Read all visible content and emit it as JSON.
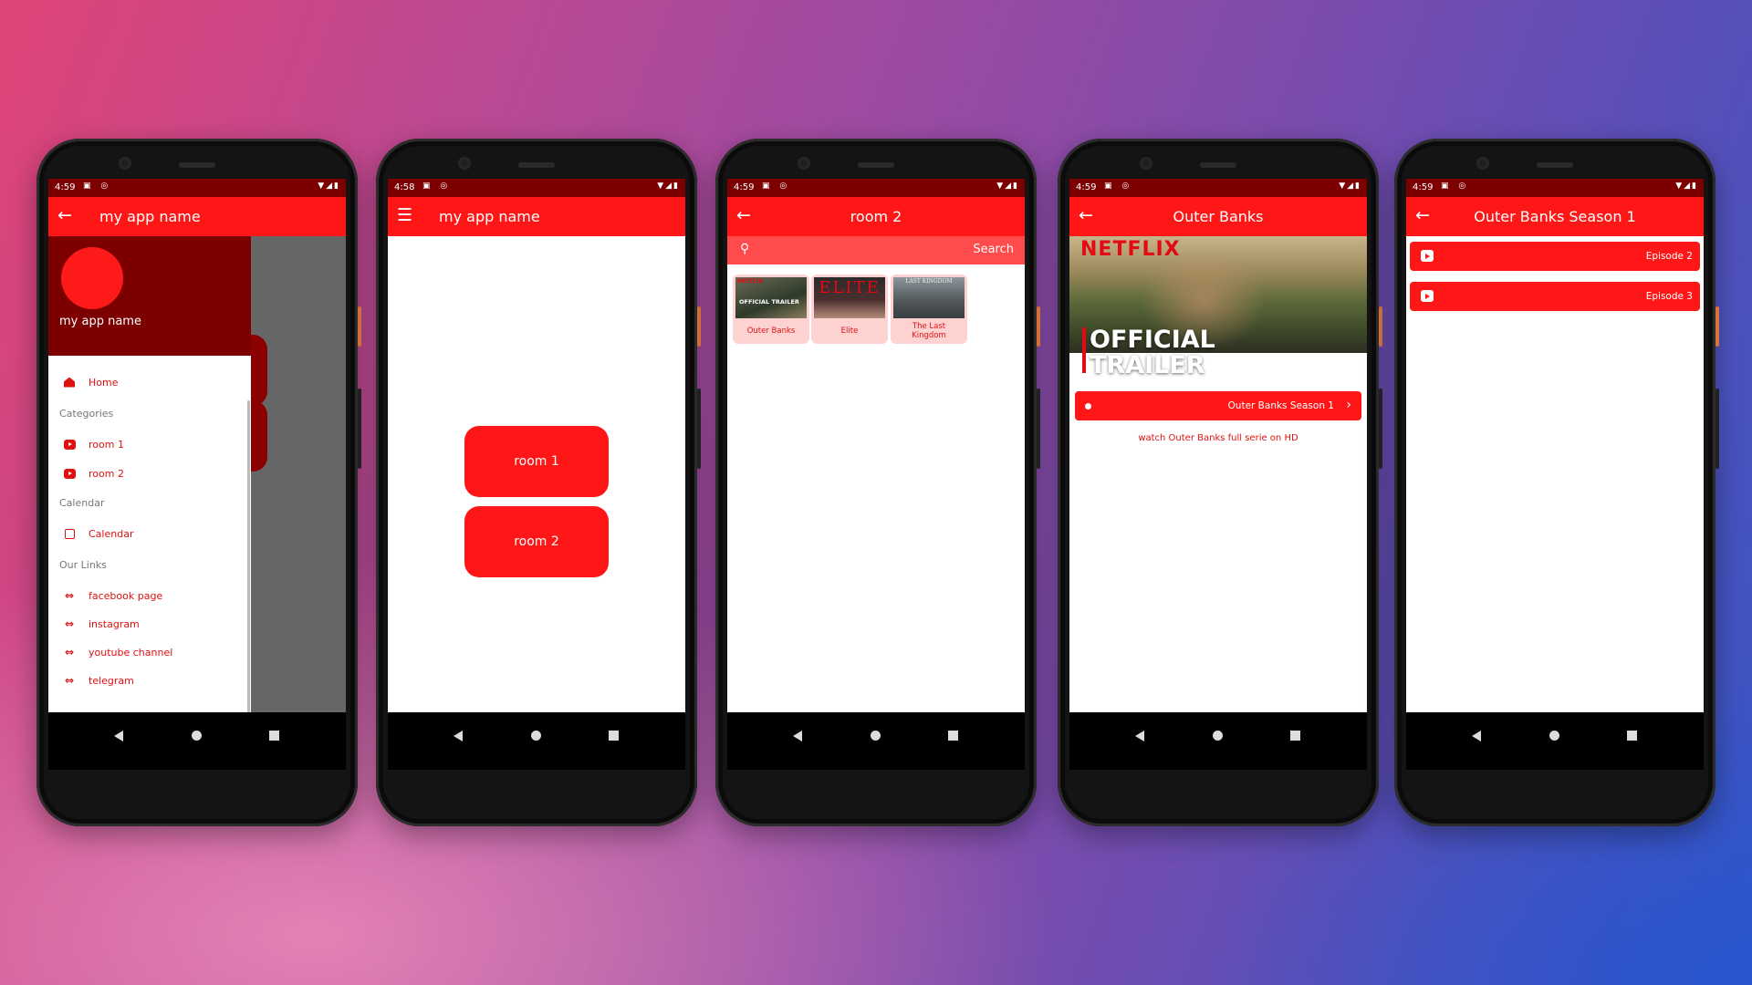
{
  "colors": {
    "primary": "#ff1717",
    "status_bar": "#7d0000",
    "drawer_header": "#7d0000",
    "card_bg": "#ffd2d2",
    "netflix_red": "#e50914"
  },
  "status": {
    "phone1_time": "4:59",
    "phone2_time": "4:58",
    "phone3_time": "4:59",
    "phone4_time": "4:59",
    "phone5_time": "4:59"
  },
  "phone1": {
    "app_title": "my app name",
    "leading_icon": "arrow-left-icon",
    "drawer": {
      "profile_name": "my app name",
      "home": "Home",
      "section_categories": "Categories",
      "room1": "room 1",
      "room2": "room 2",
      "section_calendar": "Calendar",
      "calendar": "Calendar",
      "section_links": "Our Links",
      "facebook": "facebook page",
      "instagram": "instagram",
      "youtube": "youtube channel",
      "telegram": "telegram"
    }
  },
  "phone2": {
    "app_title": "my app name",
    "leading_icon": "menu-icon",
    "room1": "room 1",
    "room2": "room 2"
  },
  "phone3": {
    "app_title": "room 2",
    "search_placeholder": "Search",
    "items": [
      {
        "label": "Outer Banks",
        "thumb_text": "OFFICIAL TRAILER",
        "thumb_brand": "NETFLIX"
      },
      {
        "label": "Elite",
        "thumb_text": "ELITE"
      },
      {
        "label": "The Last Kingdom",
        "thumb_text": "LAST KINGDOM"
      }
    ]
  },
  "phone4": {
    "app_title": "Outer Banks",
    "poster_brand": "NETFLIX",
    "poster_line1": "OFFICIAL",
    "poster_line2": "TRAILER",
    "season_button": "Outer Banks Season 1",
    "description": "watch Outer Banks full serie on HD"
  },
  "phone5": {
    "app_title": "Outer Banks Season 1",
    "episodes": [
      "Episode 2",
      "Episode 3"
    ]
  }
}
